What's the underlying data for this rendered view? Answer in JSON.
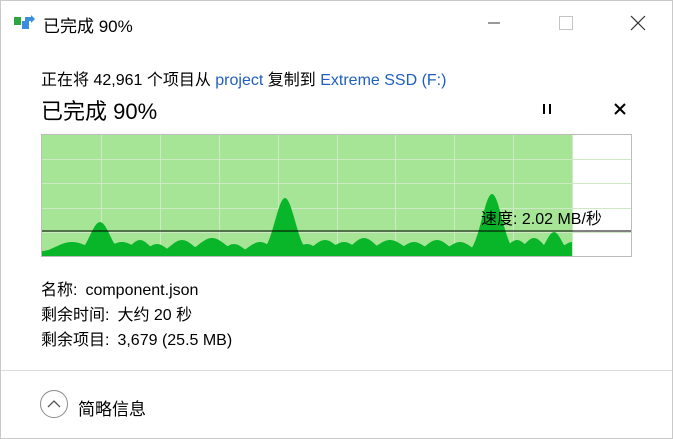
{
  "window": {
    "title": "已完成 90%",
    "app_icon": "file-copy-icon",
    "controls": [
      "minimize-icon",
      "maximize-icon",
      "close-icon"
    ]
  },
  "header": {
    "prefix": "正在将 42,961 个项目从 ",
    "source": "project",
    "middle": " 复制到 ",
    "destination": "Extreme SSD (F:)",
    "progress_text": "已完成 90%",
    "pause_icon": "pause-icon",
    "cancel_icon": "cancel-icon"
  },
  "graph": {
    "speed_text": "速度: 2.02 MB/秒",
    "progress_fraction": 0.9,
    "colors": {
      "filled": "#a5e595",
      "speed": "#09b529",
      "grid": "#cfe9c6",
      "line": "#000000"
    }
  },
  "details": {
    "name_label": "名称:",
    "name_value": "component.json",
    "time_label": "剩余时间:",
    "time_value": "大约 20 秒",
    "items_label": "剩余项目:",
    "items_value": "3,679 (25.5 MB)"
  },
  "footer": {
    "collapse_icon": "chevron-up-icon",
    "collapse_label": "简略信息"
  }
}
